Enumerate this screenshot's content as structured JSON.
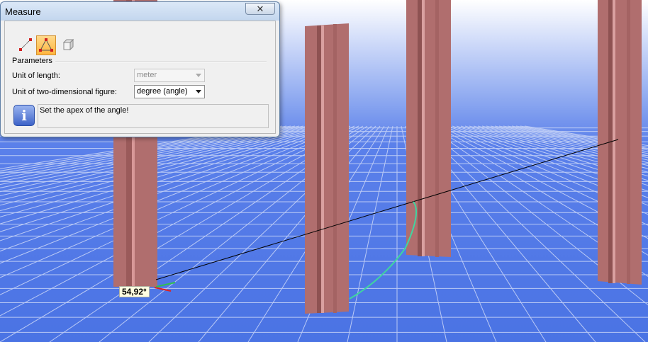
{
  "window": {
    "title": "Measure",
    "close_glyph": "✕"
  },
  "toolbar": {
    "tools": [
      {
        "icon": "distance-icon",
        "active": false
      },
      {
        "icon": "angle-icon",
        "active": true
      },
      {
        "icon": "volume-box-icon",
        "active": false
      }
    ]
  },
  "parameters": {
    "group_label": "Parameters",
    "unit_length_label": "Unit of length:",
    "unit_length_value": "meter",
    "unit_length_enabled": false,
    "unit_2d_label": "Unit of two-dimensional figure:",
    "unit_2d_value": "degree (angle)",
    "unit_2d_enabled": true
  },
  "info": {
    "icon_glyph": "i",
    "message": "Set the apex of the angle!"
  },
  "scene": {
    "measurement_value": "54,92°",
    "background_color": "#5a82e8",
    "grid_color": "#c6d3f7",
    "column_color": "#b06e6e"
  }
}
